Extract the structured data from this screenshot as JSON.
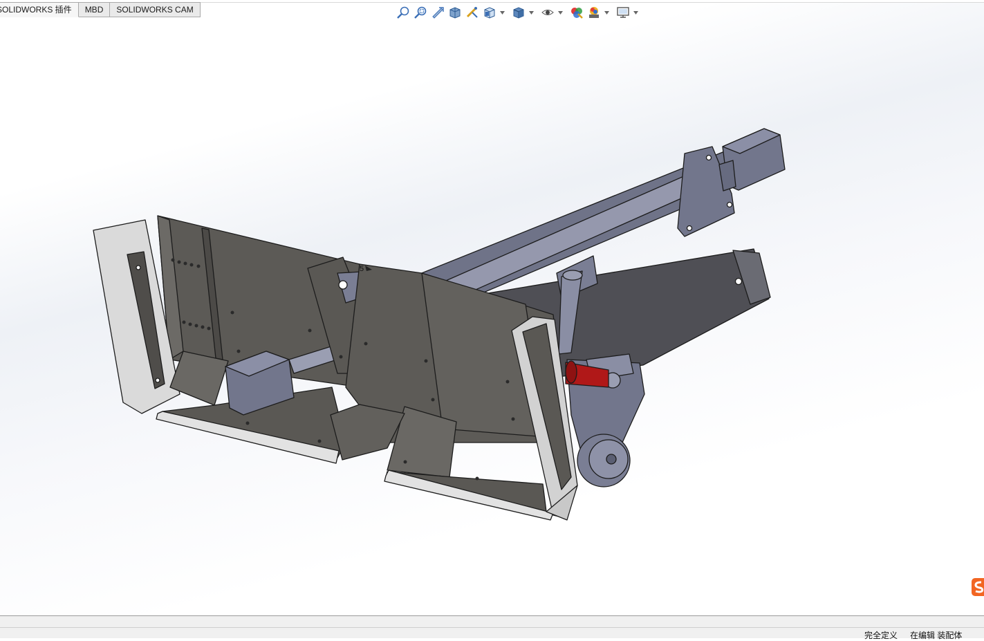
{
  "tabs": [
    {
      "label": "SOLIDWORKS 插件"
    },
    {
      "label": "MBD"
    },
    {
      "label": "SOLIDWORKS CAM"
    }
  ],
  "hud_toolbar": [
    {
      "icon": "zoom-to-fit-icon"
    },
    {
      "icon": "zoom-to-area-icon"
    },
    {
      "icon": "previous-view-icon"
    },
    {
      "icon": "section-view-icon"
    },
    {
      "icon": "dynamic-annotation-views-icon"
    },
    {
      "icon": "view-orientation-icon",
      "dropdown": true
    },
    {
      "icon": "display-style-icon",
      "dropdown": true
    },
    {
      "icon": "hide-show-items-icon",
      "dropdown": true
    },
    {
      "icon": "edit-appearance-icon"
    },
    {
      "icon": "apply-scene-icon",
      "dropdown": true
    },
    {
      "icon": "view-settings-icon",
      "dropdown": true
    }
  ],
  "model": {
    "annotation_label": "5"
  },
  "status": {
    "definition": "完全定义",
    "editing": "在编辑 装配体"
  },
  "colors": {
    "plate_dark": "#5d5a55",
    "plate_mid": "#6e6b66",
    "frame_blue": "#70748a",
    "frame_light": "#9a9eb2",
    "guard_light": "#d8d8d8",
    "cylinder_red": "#b01818",
    "watermark_orange": "#f26522"
  }
}
